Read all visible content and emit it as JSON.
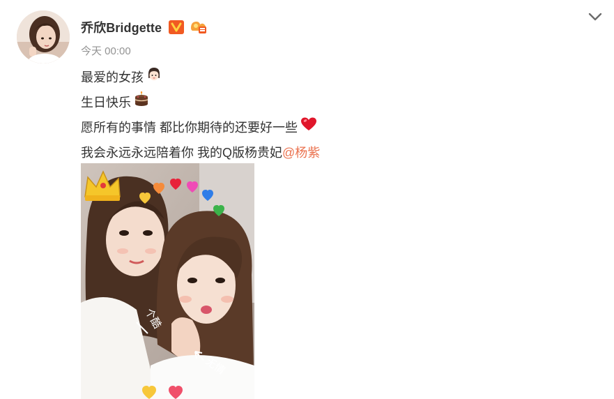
{
  "post": {
    "author": {
      "name": "乔欣Bridgette",
      "verified_badge": "verified-v-icon",
      "fan_badge": "fan-group-icon"
    },
    "timestamp": "今天 00:00",
    "menu_icon": "chevron-down-icon",
    "lines": [
      {
        "text": "最爱的女孩",
        "emoji": "girl-face-emoji"
      },
      {
        "text": "生日快乐",
        "emoji": "cake-emoji"
      },
      {
        "text": "愿所有的事情 都比你期待的还要好一些 ",
        "emoji": "red-heart-emoji"
      },
      {
        "text": "我会永远永远陪着你 我的Q版杨贵妃",
        "mention": "@杨紫"
      }
    ],
    "image": {
      "doodle_left": "个酷",
      "doodle_right": "无情"
    }
  },
  "colors": {
    "text": "#333333",
    "muted": "#939393",
    "mention": "#eb7350",
    "badge_orange": "#f15a22"
  }
}
